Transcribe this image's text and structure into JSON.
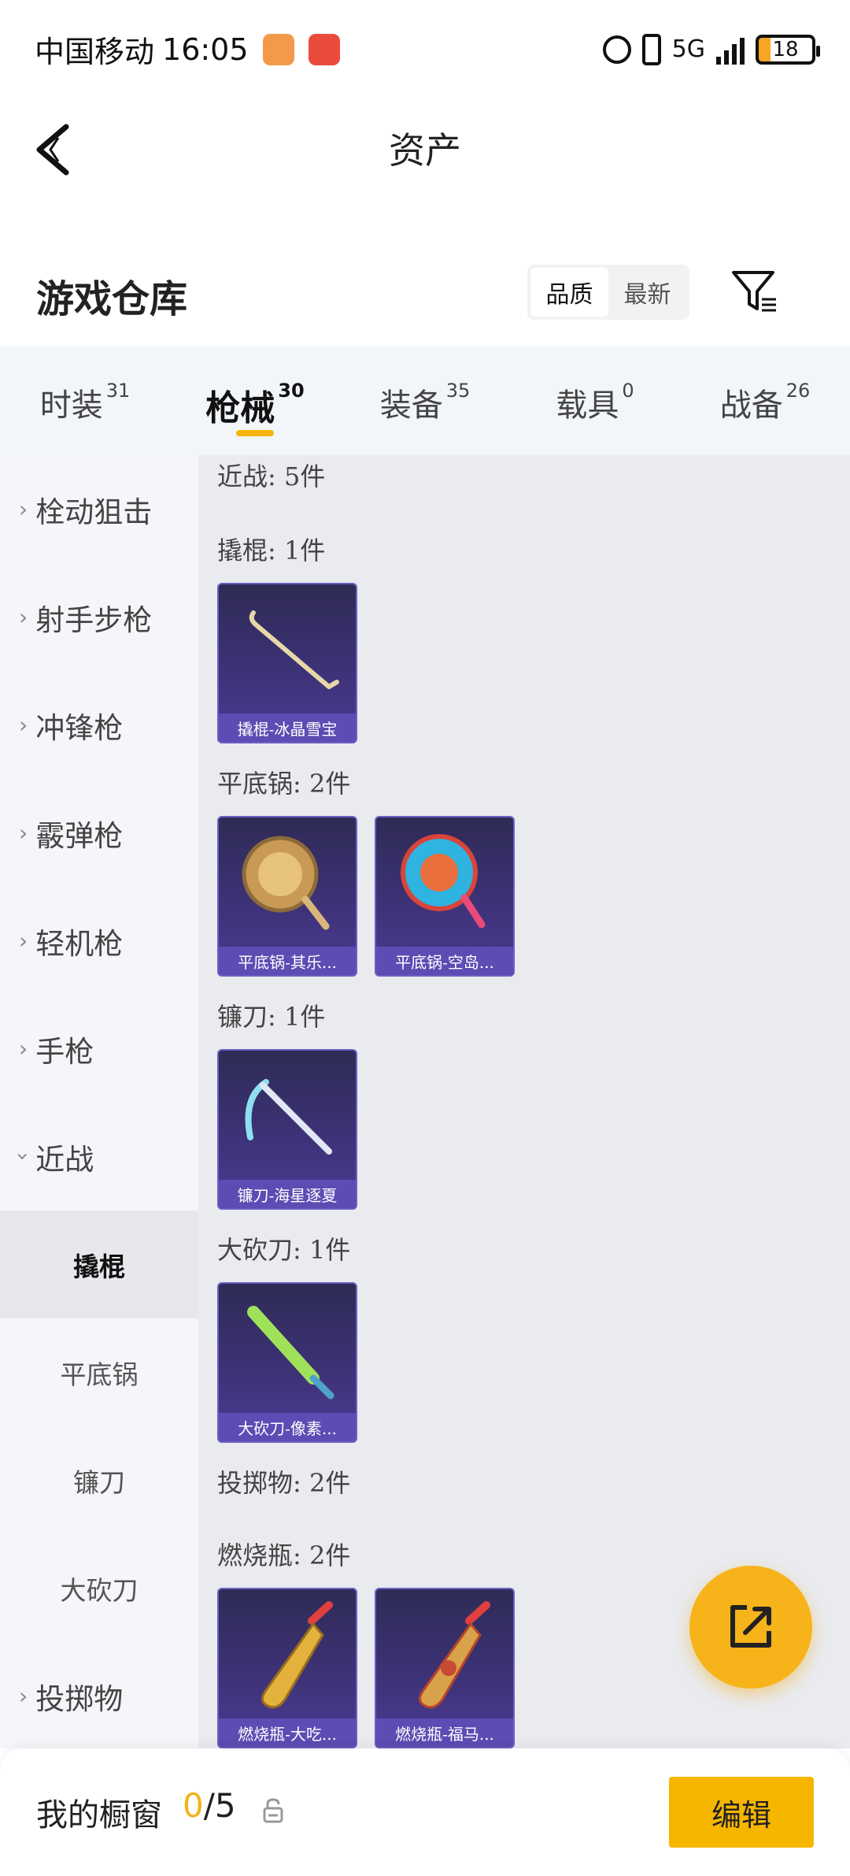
{
  "status_bar": {
    "carrier": "中国移动",
    "time": "16:05",
    "network": "5G",
    "battery": "18"
  },
  "nav": {
    "title": "资产"
  },
  "warehouse": {
    "title": "游戏仓库",
    "sort_options": [
      "品质",
      "最新"
    ],
    "sort_selected": "品质"
  },
  "tabs": [
    {
      "label": "时装",
      "count": "31"
    },
    {
      "label": "枪械",
      "count": "30"
    },
    {
      "label": "装备",
      "count": "35"
    },
    {
      "label": "载具",
      "count": "0"
    },
    {
      "label": "战备",
      "count": "26"
    }
  ],
  "active_tab": "枪械",
  "sidebar": {
    "categories": [
      "栓动狙击",
      "射手步枪",
      "冲锋枪",
      "霰弹枪",
      "轻机枪",
      "手枪",
      "近战"
    ],
    "expanded": "近战",
    "subcategories": [
      "撬棍",
      "平底锅",
      "镰刀",
      "大砍刀"
    ],
    "active_sub": "撬棍",
    "after": [
      "投掷物"
    ]
  },
  "content": {
    "sections": [
      {
        "heading": "近战: 5件"
      },
      {
        "heading": "撬棍: 1件",
        "items": [
          "撬棍-冰晶雪宝"
        ]
      },
      {
        "heading": "平底锅: 2件",
        "items": [
          "平底锅-其乐...",
          "平底锅-空岛..."
        ]
      },
      {
        "heading": "镰刀: 1件",
        "items": [
          "镰刀-海星逐夏"
        ]
      },
      {
        "heading": "大砍刀: 1件",
        "items": [
          "大砍刀-像素..."
        ]
      },
      {
        "heading": "投掷物: 2件"
      },
      {
        "heading": "燃烧瓶: 2件",
        "items": [
          "燃烧瓶-大吃...",
          "燃烧瓶-福马..."
        ]
      }
    ]
  },
  "bottom_bar": {
    "label": "我的橱窗",
    "count_current": "0",
    "count_total": "/5",
    "edit_label": "编辑"
  },
  "colors": {
    "accent": "#f6b600",
    "card_bg": "#3d3277",
    "card_caption": "#5c4cb3"
  }
}
